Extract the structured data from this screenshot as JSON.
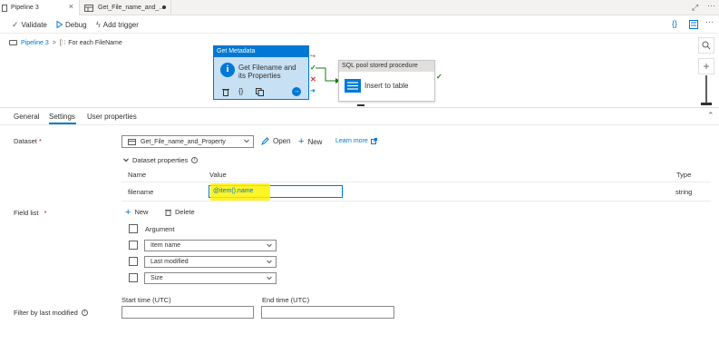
{
  "tabs": [
    {
      "label": "Pipeline 3"
    },
    {
      "label": "Get_File_name_and_..."
    }
  ],
  "toolbar": {
    "validate": "Validate",
    "debug": "Debug",
    "add_trigger": "Add trigger"
  },
  "breadcrumb": {
    "pipeline": "Pipeline 3",
    "separator": ">",
    "activity": "For each FileName"
  },
  "activities": {
    "get_metadata": {
      "type": "Get Metadata",
      "name_line1": "Get Filename and",
      "name_line2": "its Properties"
    },
    "sql_pool": {
      "type": "SQL pool stored procedure",
      "name": "Insert to table"
    }
  },
  "panel_tabs": [
    {
      "label": "General"
    },
    {
      "label": "Settings"
    },
    {
      "label": "User properties"
    }
  ],
  "dataset": {
    "label": "Dataset",
    "required": "*",
    "value": "Get_File_name_and_Property",
    "open": "Open",
    "new": "New",
    "learn_more": "Learn more"
  },
  "dataset_properties": {
    "title": "Dataset properties",
    "columns": [
      "Name",
      "Value",
      "Type"
    ],
    "rows": [
      {
        "name": "filename",
        "value": "@item().name",
        "type": "string"
      }
    ]
  },
  "field_list": {
    "label": "Field list",
    "required": "*",
    "new": "New",
    "delete": "Delete",
    "header": "Argument",
    "items": [
      "Item name",
      "Last modified",
      "Size"
    ]
  },
  "filter": {
    "label": "Filter by last modified",
    "start": "Start time (UTC)",
    "end": "End time (UTC)"
  },
  "colors": {
    "accent": "#0078d4",
    "highlight": "#fff200",
    "success": "#107c10",
    "failure": "#d13438"
  }
}
